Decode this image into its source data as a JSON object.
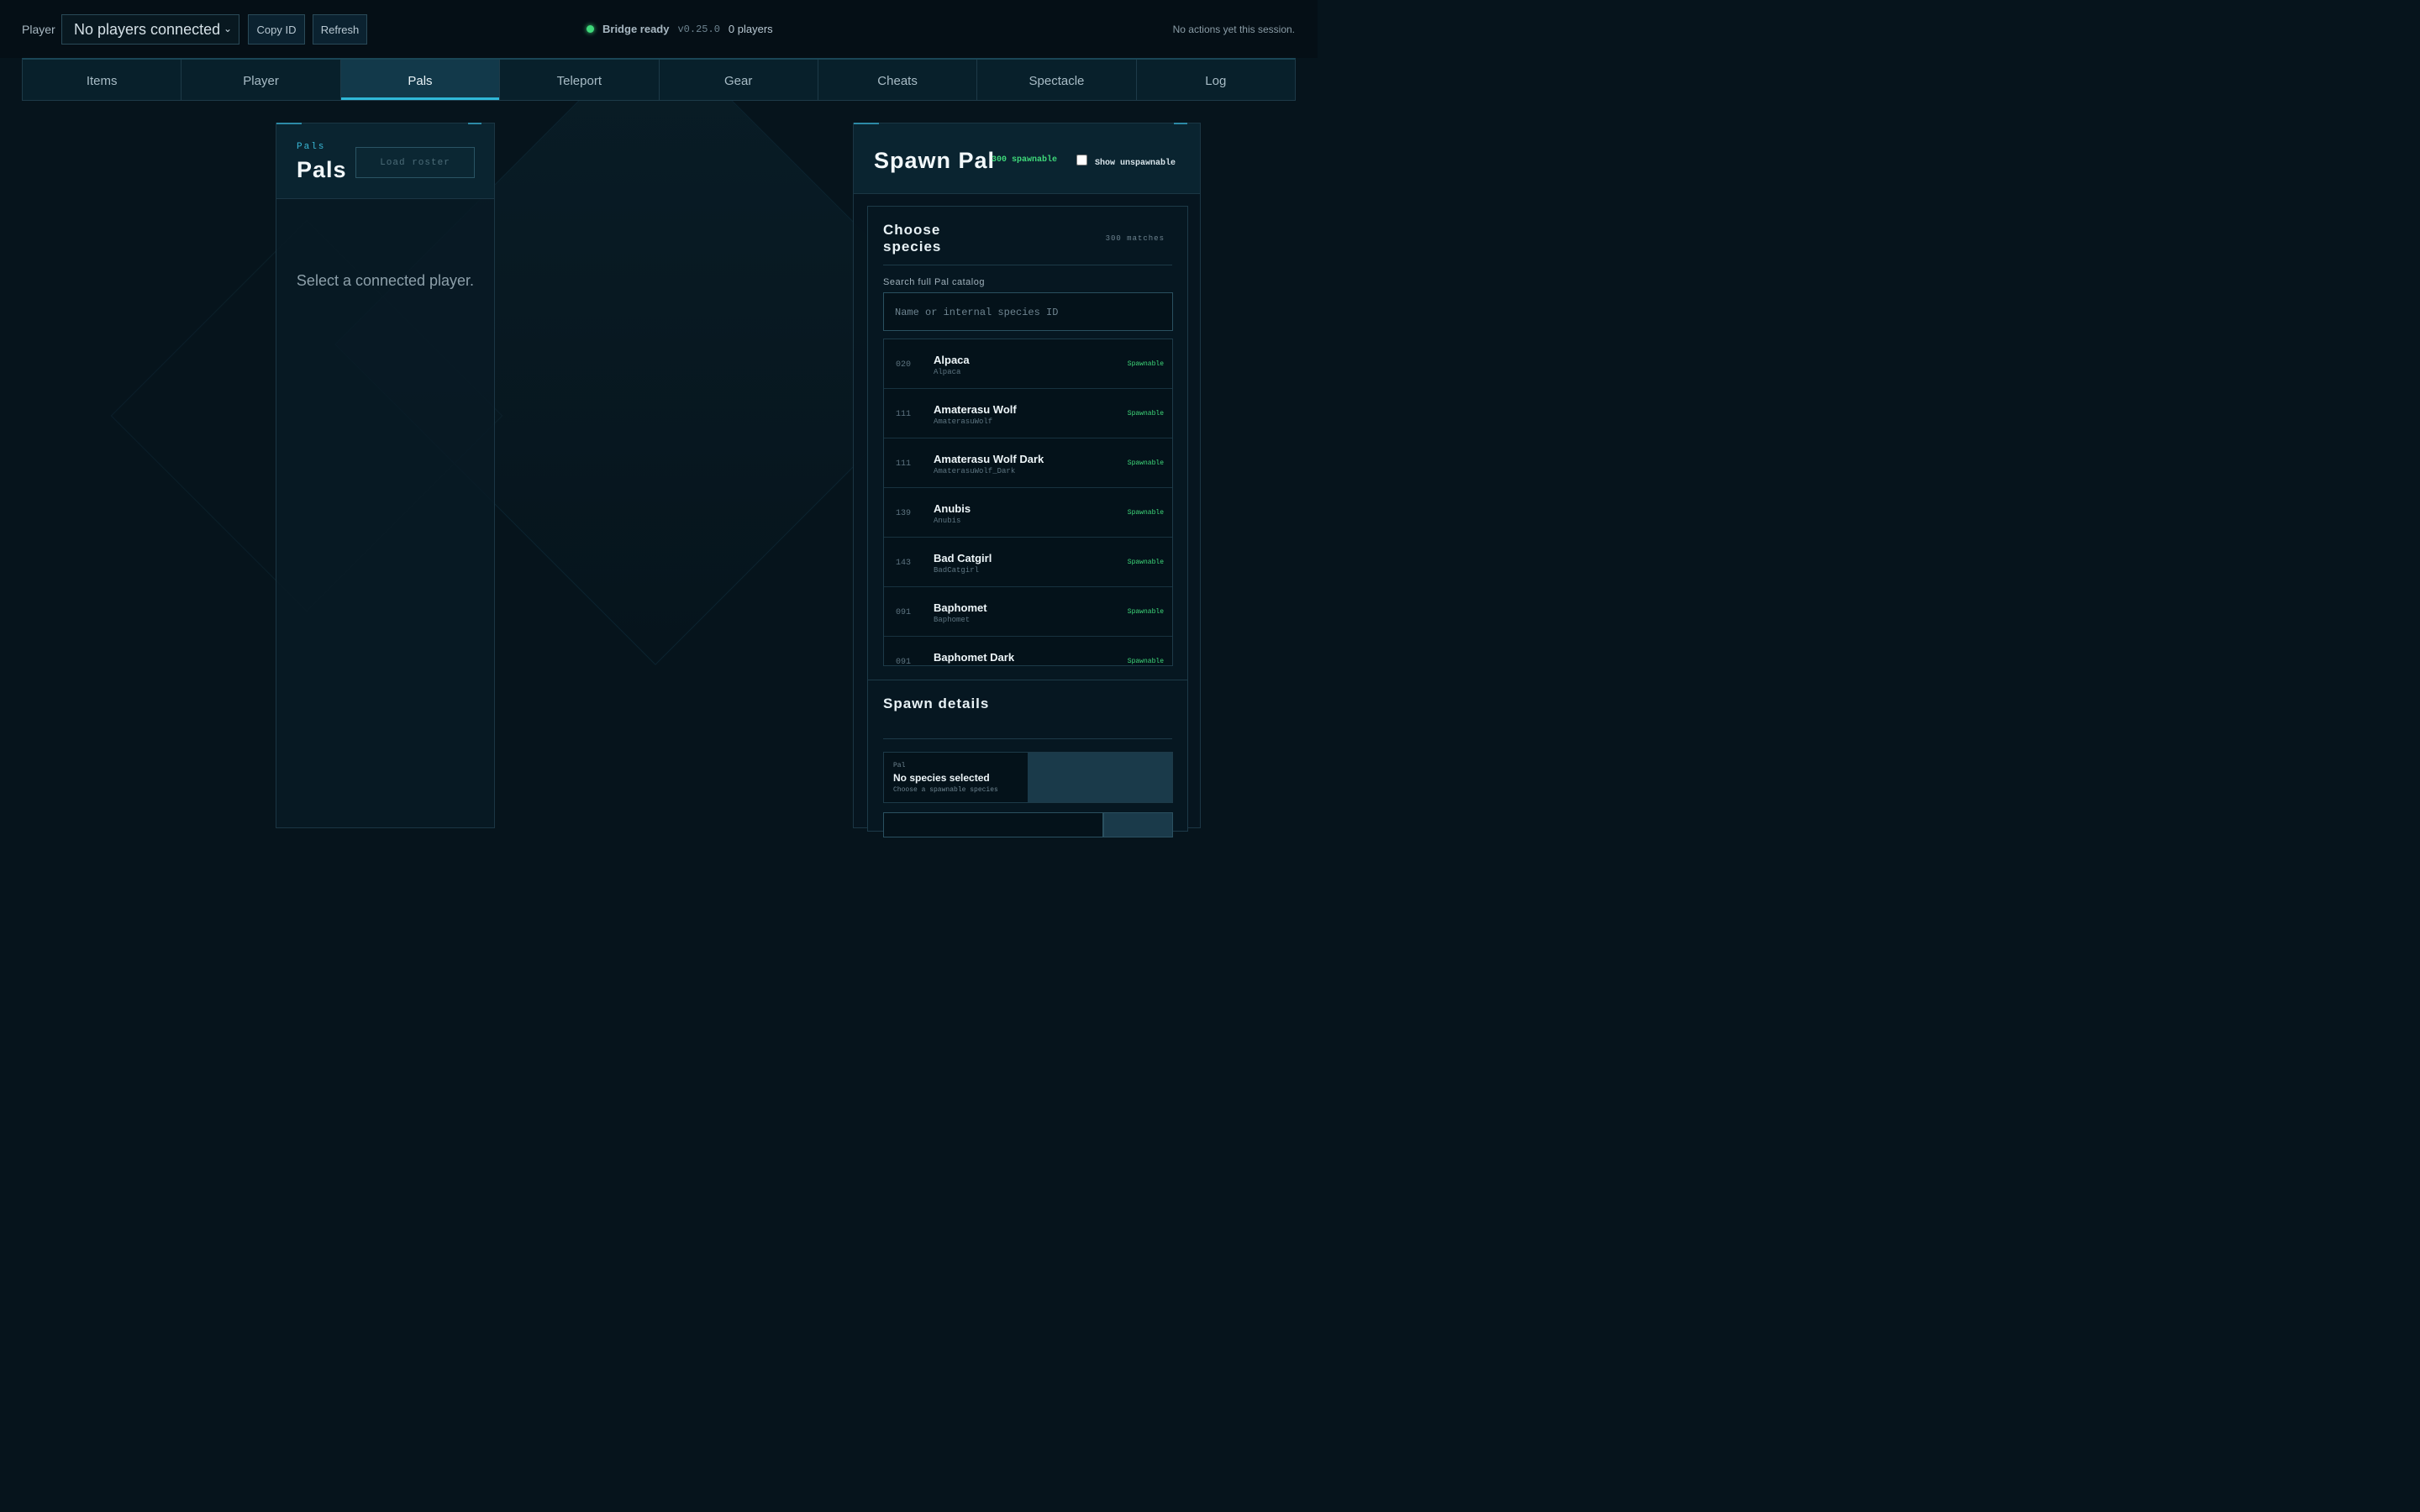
{
  "topbar": {
    "player_label": "Player",
    "player_select": "No players connected",
    "copy_id": "Copy ID",
    "refresh": "Refresh",
    "status": "Bridge ready",
    "version": "v0.25.0",
    "player_count": "0 players",
    "actions_msg": "No actions yet this session."
  },
  "tabs": [
    "Items",
    "Player",
    "Pals",
    "Teleport",
    "Gear",
    "Cheats",
    "Spectacle",
    "Log"
  ],
  "active_tab": "Pals",
  "pals_panel": {
    "eyebrow": "Pals",
    "title": "Pals",
    "load_button": "Load roster",
    "empty_message": "Select a connected player."
  },
  "spawn_panel": {
    "title": "Spawn Pal",
    "spawnable_count": "300 spawnable",
    "show_unspawnable": "Show unspawnable",
    "show_unspawnable_checked": false,
    "choose_title": "Choose species",
    "matches": "300 matches",
    "search_label": "Search full Pal catalog",
    "search_placeholder": "Name or internal species ID",
    "species": [
      {
        "num": "020",
        "name": "Alpaca",
        "id": "Alpaca",
        "status": "Spawnable"
      },
      {
        "num": "111",
        "name": "Amaterasu Wolf",
        "id": "AmaterasuWolf",
        "status": "Spawnable"
      },
      {
        "num": "111",
        "name": "Amaterasu Wolf Dark",
        "id": "AmaterasuWolf_Dark",
        "status": "Spawnable"
      },
      {
        "num": "139",
        "name": "Anubis",
        "id": "Anubis",
        "status": "Spawnable"
      },
      {
        "num": "143",
        "name": "Bad Catgirl",
        "id": "BadCatgirl",
        "status": "Spawnable"
      },
      {
        "num": "091",
        "name": "Baphomet",
        "id": "Baphomet",
        "status": "Spawnable"
      },
      {
        "num": "091",
        "name": "Baphomet Dark",
        "id": "",
        "status": "Spawnable"
      }
    ],
    "details_title": "Spawn details",
    "pal_label": "Pal",
    "pal_selected": "No species selected",
    "pal_hint": "Choose a spawnable species"
  },
  "colors": {
    "accent": "#2fb8d8",
    "spawnable": "#3fd97a",
    "background": "#06141c"
  }
}
